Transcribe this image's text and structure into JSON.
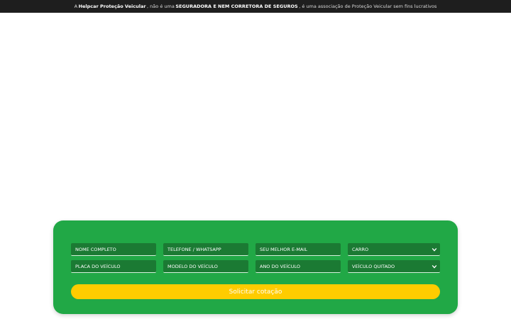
{
  "topbar": {
    "p1": "A",
    "brand": "Helpcar Proteção Veicular",
    "p2": ", não é uma",
    "emph": "SEGURADORA E NEM CORRETORA DE SEGUROS",
    "p3": ", é uma associação de Proteção Veicular sem fins lucrativos"
  },
  "form": {
    "name_placeholder": "NOME COMPLETO",
    "phone_placeholder": "TELEFONE / WHATSAPP",
    "email_placeholder": "SEU MELHOR E-MAIL",
    "vehicle_type": "CARRO",
    "plate_placeholder": "PLACA DO VEÍCULO",
    "model_placeholder": "MODELO DO VEÍCULO",
    "year_placeholder": "ANO DO VEÍCULO",
    "paid_off": "VEÍCULO QUITADO",
    "submit_label": "Solicitar cotação"
  },
  "colors": {
    "topbar_bg": "#1e1e1e",
    "card_bg": "#21a846",
    "field_bg": "#1b7a33",
    "button_bg": "#ffcc00"
  },
  "icons": {
    "select_arrow": "chevron-down-icon"
  }
}
